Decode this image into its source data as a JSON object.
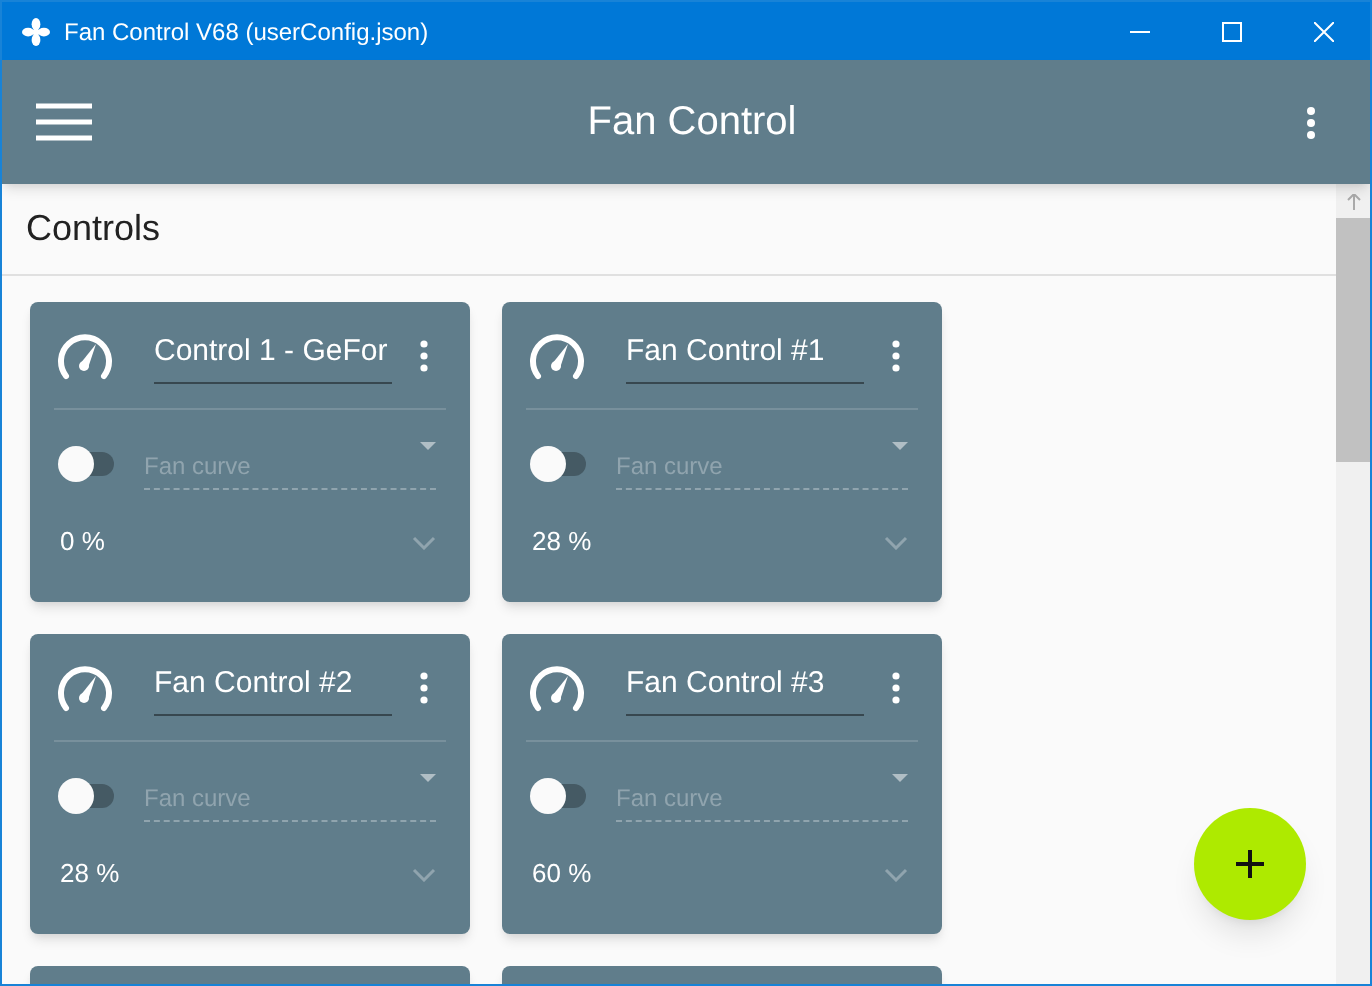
{
  "window": {
    "title": "Fan Control V68 (userConfig.json)"
  },
  "app_bar": {
    "title": "Fan Control"
  },
  "section": {
    "title": "Controls"
  },
  "controls": [
    {
      "name": "Control 1 - GeFor",
      "enabled": false,
      "curve_placeholder": "Fan curve",
      "reading": "0 %"
    },
    {
      "name": "Fan Control #1",
      "enabled": false,
      "curve_placeholder": "Fan curve",
      "reading": "28 %"
    },
    {
      "name": "Fan Control #2",
      "enabled": false,
      "curve_placeholder": "Fan curve",
      "reading": "28 %"
    },
    {
      "name": "Fan Control #3",
      "enabled": false,
      "curve_placeholder": "Fan curve",
      "reading": "60 %"
    }
  ]
}
